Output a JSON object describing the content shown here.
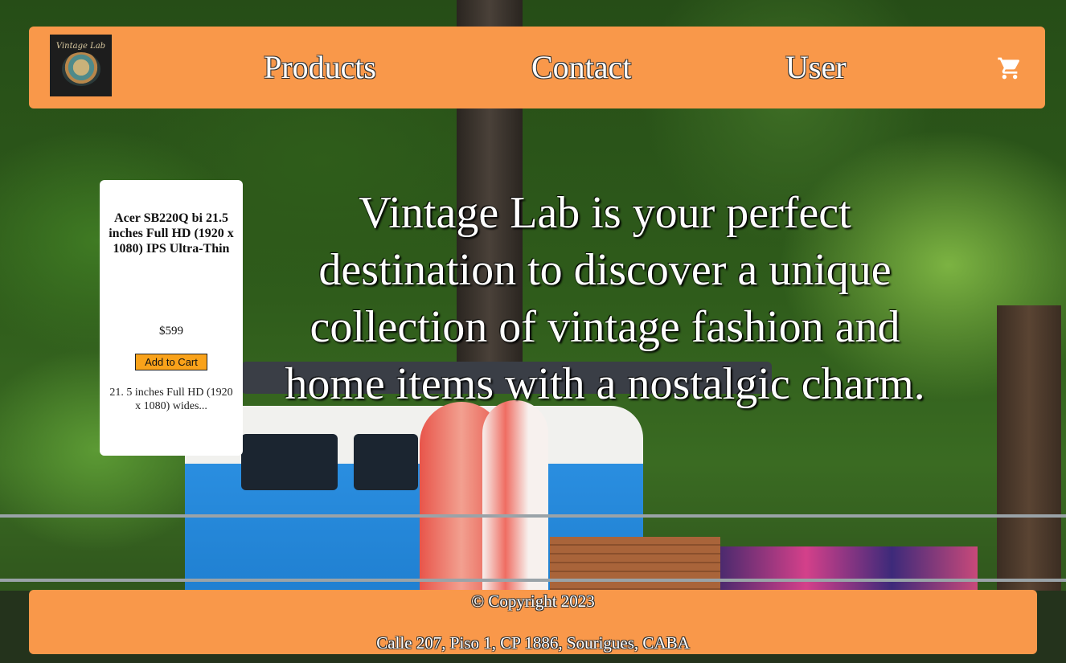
{
  "header": {
    "logo_text": "Vintage Lab",
    "nav": [
      {
        "label": "Products"
      },
      {
        "label": "Contact"
      },
      {
        "label": "User"
      }
    ],
    "cart_icon": "shopping-cart-icon"
  },
  "product": {
    "title": "Acer SB220Q bi 21.5 inches Full HD (1920 x 1080) IPS Ultra-Thin",
    "price": "$599",
    "button_label": "Add to Cart",
    "description": "21. 5 inches Full HD (1920 x 1080) wides..."
  },
  "hero": {
    "text": "Vintage Lab is your perfect destination to discover a unique collection of vintage fashion and home items with a nostalgic charm."
  },
  "footer": {
    "copyright": "© Copyright 2023",
    "address": "Calle 207, Piso 1, CP 1886, Sourigues, CABA"
  },
  "colors": {
    "accent": "#f9984a",
    "button": "#f9a21a"
  }
}
